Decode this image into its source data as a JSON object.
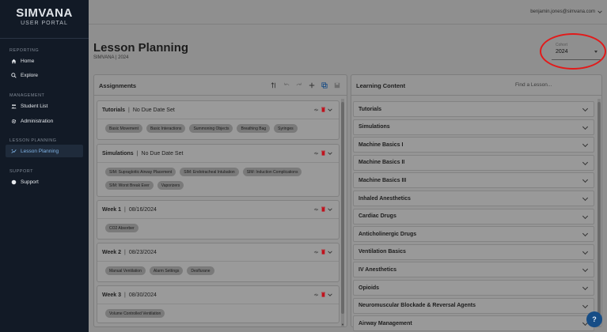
{
  "brand": {
    "name": "SIMVANA",
    "subtitle": "USER PORTAL"
  },
  "sidebar": {
    "sections": [
      {
        "label": "REPORTING",
        "items": [
          {
            "label": "Home",
            "icon": "home-icon"
          },
          {
            "label": "Explore",
            "icon": "search-icon"
          }
        ]
      },
      {
        "label": "MANAGEMENT",
        "items": [
          {
            "label": "Student List",
            "icon": "people-icon"
          },
          {
            "label": "Administration",
            "icon": "gear-icon"
          }
        ]
      },
      {
        "label": "LESSON PLANNING",
        "items": [
          {
            "label": "Lesson Planning",
            "icon": "lesson-icon",
            "active": true
          }
        ]
      },
      {
        "label": "SUPPORT",
        "items": [
          {
            "label": "Support",
            "icon": "help-circle-icon"
          }
        ]
      }
    ]
  },
  "header": {
    "user_email": "benjamin.jones@simvana.com"
  },
  "page": {
    "title": "Lesson Planning",
    "subtitle": "SIMVANA | 2024"
  },
  "cohort": {
    "label": "Cohort",
    "value": "2024"
  },
  "assignments": {
    "title": "Assignments",
    "cards": [
      {
        "name": "Tutorials",
        "due": "No Due Date Set",
        "chips": [
          "Basic Movement",
          "Basic Interactions",
          "Summoning Objects",
          "Breathing Bag",
          "Syringes"
        ]
      },
      {
        "name": "Simulations",
        "due": "No Due Date Set",
        "chips": [
          "SIM: Supraglottic Airway Placement",
          "SIM: Endotracheal Intubation",
          "SIM: Induction Complications",
          "SIM: Worst Break Ever",
          "Vaporizers"
        ]
      },
      {
        "name": "Week 1",
        "due": "08/16/2024",
        "chips": [
          "CO2 Absorber"
        ]
      },
      {
        "name": "Week 2",
        "due": "08/23/2024",
        "chips": [
          "Manual Ventilation",
          "Alarm Settings",
          "Desflurane"
        ]
      },
      {
        "name": "Week 3",
        "due": "08/30/2024",
        "chips": [
          "Volume Controlled Ventilation"
        ]
      }
    ]
  },
  "learning_content": {
    "title": "Learning Content",
    "search_placeholder": "Find a Lesson...",
    "items": [
      "Tutorials",
      "Simulations",
      "Machine Basics I",
      "Machine Basics II",
      "Machine Basics III",
      "Inhaled Anesthetics",
      "Cardiac Drugs",
      "Anticholinergic Drugs",
      "Ventilation Basics",
      "IV Anesthetics",
      "Opioids",
      "Neuromuscular Blockade & Reversal Agents",
      "Airway Management"
    ]
  },
  "help_button": {
    "label": "?"
  },
  "colors": {
    "sidebar_bg": "#121a26",
    "active_nav": "#7fb2e5",
    "highlight": "#e21a1a",
    "help_bg": "#164d86",
    "delete_red": "#c0121d"
  }
}
